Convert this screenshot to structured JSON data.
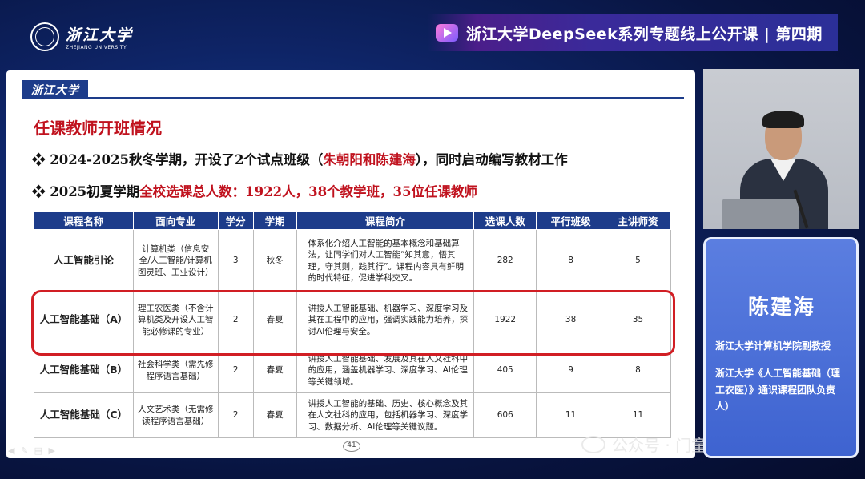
{
  "header": {
    "logo_cn": "浙江大学",
    "logo_en": "ZHEJIANG UNIVERSITY",
    "banner_title": "浙江大学DeepSeek系列专题线上公开课 | 第四期"
  },
  "slide": {
    "logo": "浙江大学",
    "title": "任课教师开班情况",
    "bullet1_prefix": "❖ 2024-2025秋冬学期，开设了2个试点班级（",
    "bullet1_red": "朱朝阳和陈建海",
    "bullet1_suffix": "），同时启动编写教材工作",
    "bullet2_prefix": "❖ 2025初夏学期",
    "bullet2_red": "全校选课总人数：1922人，38个教学班，35位任课教师",
    "page_number": "41",
    "tools": "◀ ✎ ▤ ▶"
  },
  "table": {
    "headers": [
      "课程名称",
      "面向专业",
      "学分",
      "学期",
      "课程简介",
      "选课人数",
      "平行班级",
      "主讲师资"
    ],
    "rows": [
      {
        "name": "人工智能引论",
        "major": "计算机类（信息安全/人工智能/计算机图灵班、工业设计）",
        "credit": "3",
        "term": "秋冬",
        "intro": "体系化介绍人工智能的基本概念和基础算法，让同学们对人工智能“知其意，悟其理，守其则，践其行”。课程内容具有鲜明的时代特征，促进学科交叉。",
        "enrolled": "282",
        "classes": "8",
        "teachers": "5"
      },
      {
        "name": "人工智能基础（A）",
        "major": "理工农医类（不含计算机类及开设人工智能必修课的专业）",
        "credit": "2",
        "term": "春夏",
        "intro": "讲授人工智能基础、机器学习、深度学习及其在工程中的应用，强调实践能力培养，探讨AI伦理与安全。",
        "enrolled": "1922",
        "classes": "38",
        "teachers": "35"
      },
      {
        "name": "人工智能基础（B）",
        "major": "社会科学类（需先修程序语言基础）",
        "credit": "2",
        "term": "春夏",
        "intro": "讲授人工智能基础、发展及其在人文社科中的应用，涵盖机器学习、深度学习、AI伦理等关键领域。",
        "enrolled": "405",
        "classes": "9",
        "teachers": "8"
      },
      {
        "name": "人工智能基础（C）",
        "major": "人文艺术类（无需修读程序语言基础）",
        "credit": "2",
        "term": "春夏",
        "intro": "讲授人工智能的基础、历史、核心概念及其在人文社科的应用，包括机器学习、深度学习、数据分析、AI伦理等关键议题。",
        "enrolled": "606",
        "classes": "11",
        "teachers": "11"
      }
    ]
  },
  "speaker": {
    "name": "陈建海",
    "title": "浙江大学计算机学院副教授",
    "role": "浙江大学《人工智能基础（理工农医）》通识课程团队负责人）"
  },
  "watermark": "公众号 · 门童靖博士"
}
